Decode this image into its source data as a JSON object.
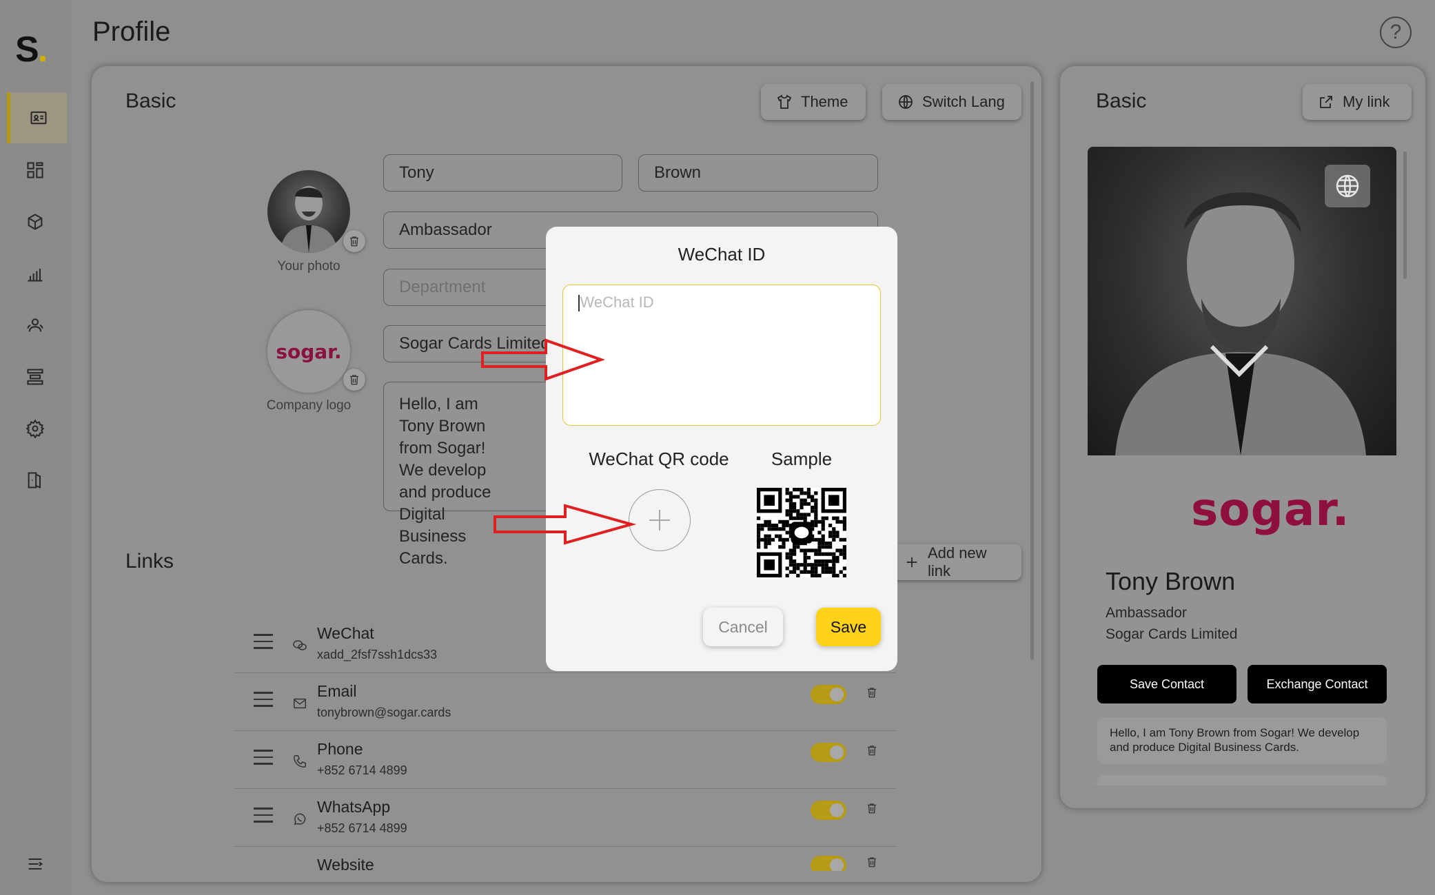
{
  "app": {
    "logo_letter": "S",
    "logo_dot": ".",
    "page_title": "Profile"
  },
  "sidebar": {
    "items": [
      {
        "name": "profile-card-icon",
        "active": true
      },
      {
        "name": "dashboard-grid-icon"
      },
      {
        "name": "cube-icon"
      },
      {
        "name": "bar-chart-icon"
      },
      {
        "name": "users-icon"
      },
      {
        "name": "layers-icon"
      },
      {
        "name": "gear-icon"
      },
      {
        "name": "logout-door-icon"
      }
    ],
    "collapse_icon": "menu-collapse-icon"
  },
  "help_icon": "?",
  "basic": {
    "title": "Basic",
    "theme_label": "Theme",
    "switch_lang_label": "Switch Lang",
    "first_name": "Tony",
    "last_name": "Brown",
    "job_title": "Ambassador",
    "department_placeholder": "Department",
    "company": "Sogar Cards Limited",
    "bio": "Hello, I am Tony Brown from Sogar! We develop and produce Digital Business Cards.",
    "photo_caption": "Your photo",
    "logo_caption": "Company logo",
    "logo_text": "sogar."
  },
  "links": {
    "title": "Links",
    "add_label": "Add new link",
    "items": [
      {
        "title": "WeChat",
        "value": "xadd_2fsf7ssh1dcs33",
        "icon": "wechat-icon"
      },
      {
        "title": "Email",
        "value": "tonybrown@sogar.cards",
        "icon": "mail-icon",
        "enabled": true
      },
      {
        "title": "Phone",
        "value": "+852 6714 4899",
        "icon": "phone-icon",
        "enabled": true
      },
      {
        "title": "WhatsApp",
        "value": "+852 6714 4899",
        "icon": "whatsapp-icon",
        "enabled": true
      },
      {
        "title": "Website",
        "value": "",
        "icon": "globe-icon",
        "enabled": true
      }
    ]
  },
  "preview": {
    "title": "Basic",
    "my_link_label": "My link",
    "logo_text": "sogar.",
    "name": "Tony Brown",
    "job_title": "Ambassador",
    "company": "Sogar Cards Limited",
    "save_contact": "Save Contact",
    "exchange_contact": "Exchange Contact",
    "bio": "Hello, I am Tony Brown from Sogar! We develop and produce Digital Business Cards."
  },
  "modal": {
    "title": "WeChat ID",
    "input_placeholder": "WeChat ID",
    "qr_label": "WeChat QR code",
    "sample_label": "Sample",
    "cancel_label": "Cancel",
    "save_label": "Save"
  },
  "colors": {
    "accent": "#ffd21a",
    "brand": "#c8124f",
    "annotation_arrow": "#e02020"
  }
}
